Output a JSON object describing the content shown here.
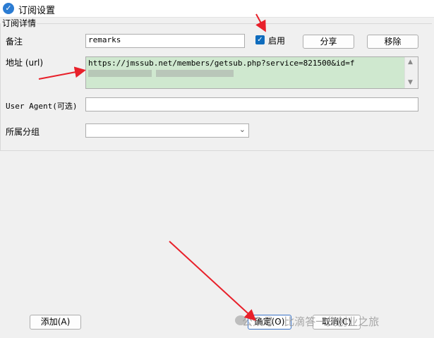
{
  "window": {
    "title": "订阅设置"
  },
  "group": {
    "title": "订阅详情"
  },
  "form": {
    "remark_label": "备注",
    "remark_value": "remarks",
    "enable_label": "启用",
    "share_button": "分享",
    "remove_button": "移除",
    "url_label": "地址 (url)",
    "url_value": "https://jmssub.net/members/getsub.php?service=821500&id=f",
    "ua_label": "User Agent(可选)",
    "ua_value": "",
    "group_label": "所属分组",
    "group_value": ""
  },
  "footer": {
    "add_button": "添加(A)",
    "ok_button": "确定(O)",
    "cancel_button": "取消(C)"
  },
  "watermark": {
    "text": "公众号 · 比滴答一货创业之旅"
  },
  "colors": {
    "accent": "#0f6cbd",
    "annotation_arrow": "#e8202a",
    "url_highlight": "#cfe8cf"
  },
  "icons": {
    "app": "app-logo-icon",
    "checkbox": "check-icon",
    "dropdown": "chevron-down-icon"
  }
}
